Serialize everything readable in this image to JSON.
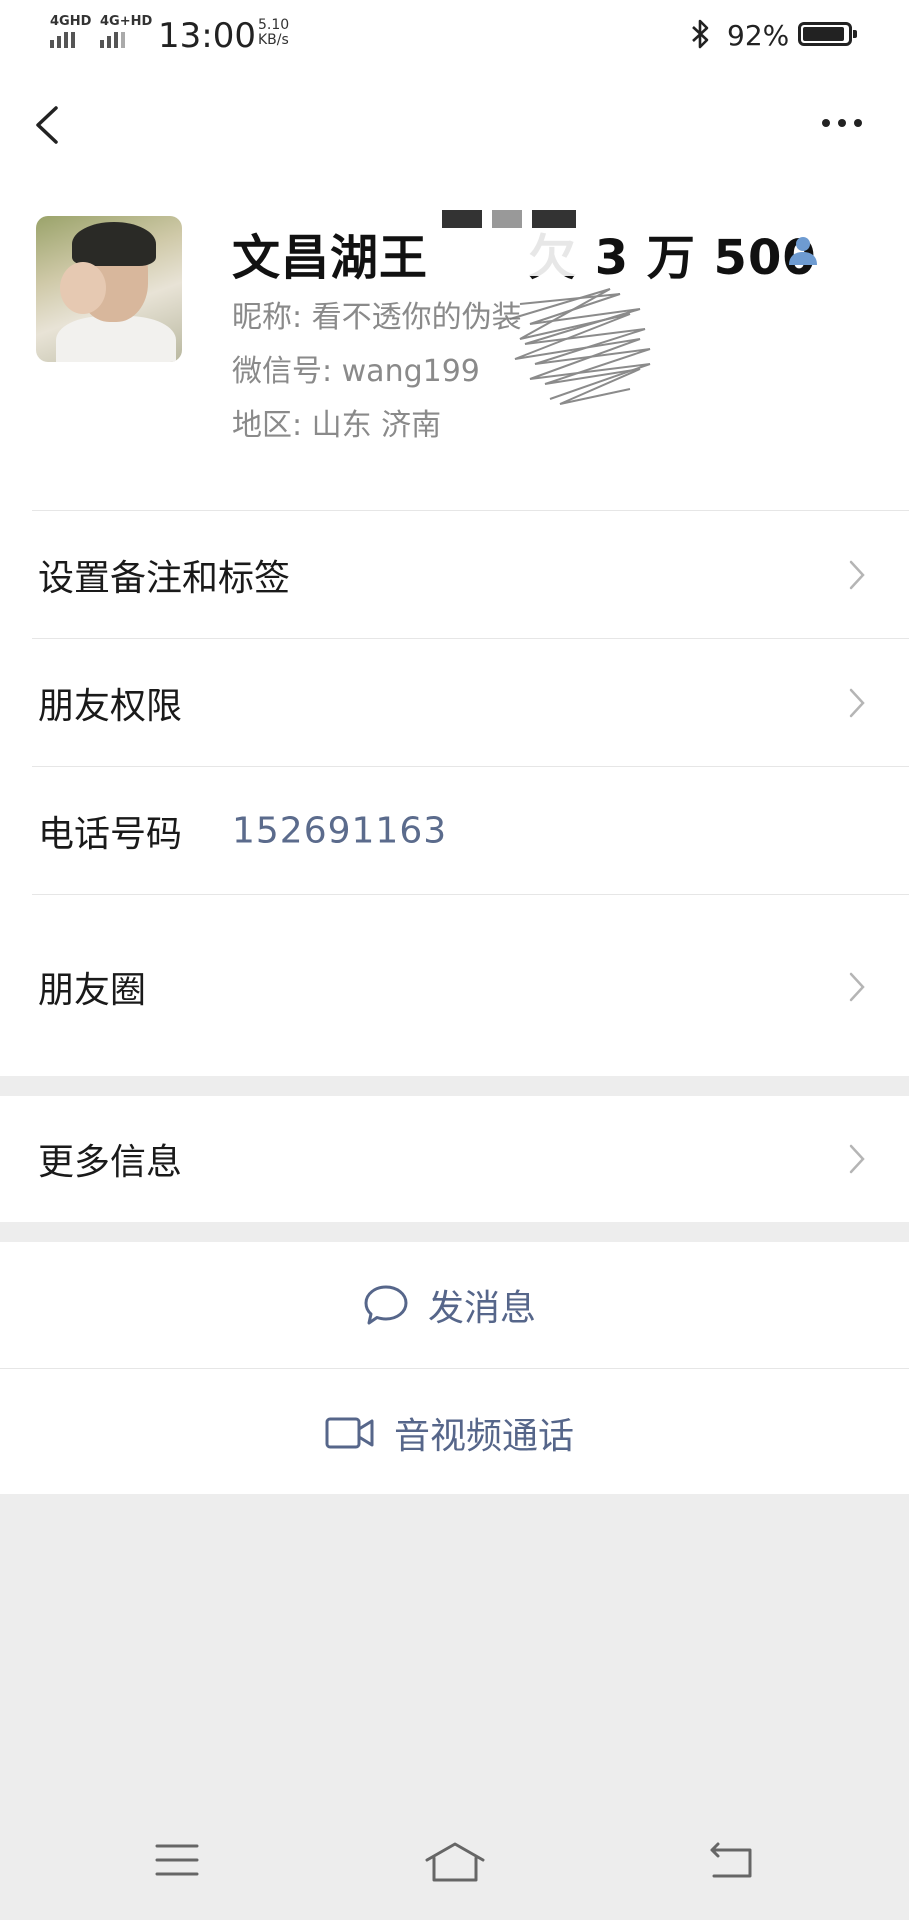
{
  "status_bar": {
    "signal1": "4GHD",
    "signal2": "4G+HD",
    "time": "13:00",
    "speed_value": "5.10",
    "speed_unit": "KB/s",
    "battery": "92%",
    "battery_level": 0.92
  },
  "profile": {
    "name": "文昌湖王",
    "name_suffix": "欠 3 万 500",
    "nickname": "昵称: 看不透你的伪装",
    "wechat_id": "微信号: wang199",
    "region": "地区: 山东  济南"
  },
  "rows": {
    "remark": "设置备注和标签",
    "permissions": "朋友权限",
    "phone_label": "电话号码",
    "phone_value": "152691163",
    "moments": "朋友圈",
    "more_info": "更多信息"
  },
  "actions": {
    "message": "发消息",
    "video_call": "音视频通话"
  },
  "colors": {
    "accent_text": "#56668a",
    "background_gray": "#ededed"
  }
}
